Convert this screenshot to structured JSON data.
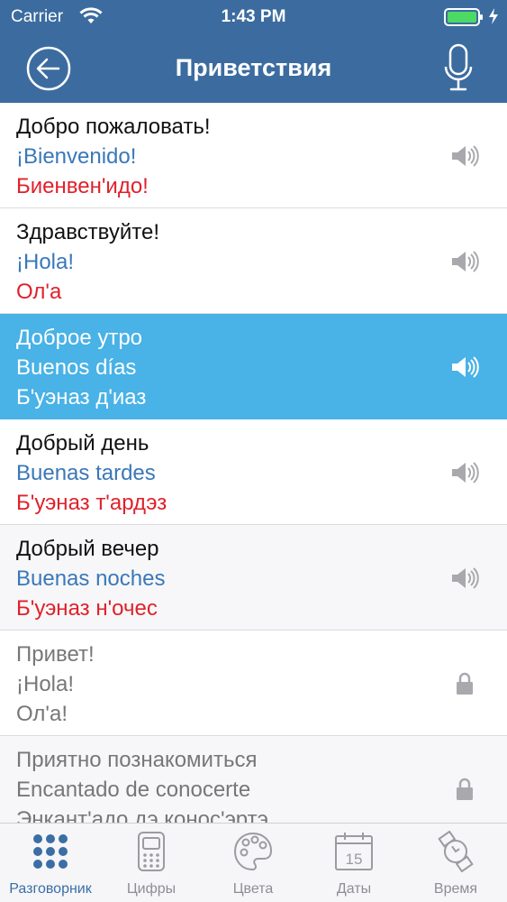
{
  "status_bar": {
    "carrier": "Carrier",
    "time": "1:43 PM"
  },
  "nav": {
    "title": "Приветствия"
  },
  "phrases": [
    {
      "ru": "Добро пожаловать!",
      "es": "¡Bienvenido!",
      "tr": "Биенвен'идо!",
      "state": "normal",
      "icon": "speaker-icon"
    },
    {
      "ru": "Здравствуйте!",
      "es": "¡Hola!",
      "tr": "Ол'а",
      "state": "normal",
      "icon": "speaker-icon"
    },
    {
      "ru": "Доброе утро",
      "es": "Buenos días",
      "tr": "Б'уэназ д'иаз",
      "state": "selected",
      "icon": "speaker-icon"
    },
    {
      "ru": "Добрый день",
      "es": "Buenas tardes",
      "tr": "Б'уэназ т'ардэз",
      "state": "normal",
      "icon": "speaker-icon"
    },
    {
      "ru": "Добрый вечер",
      "es": "Buenas noches",
      "tr": "Б'уэназ н'очес",
      "state": "normal",
      "icon": "speaker-icon"
    },
    {
      "ru": "Привет!",
      "es": "¡Hola!",
      "tr": "Ол'а!",
      "state": "locked",
      "icon": "lock-icon"
    },
    {
      "ru": "Приятно познакомиться",
      "es": "Encantado de conocerte",
      "tr": "Энкант'адо дэ конос'эртэ",
      "state": "locked",
      "icon": "lock-icon"
    }
  ],
  "tabs": [
    {
      "label": "Разговорник",
      "icon": "grid-dots-icon",
      "active": true
    },
    {
      "label": "Цифры",
      "icon": "calculator-icon",
      "active": false
    },
    {
      "label": "Цвета",
      "icon": "palette-icon",
      "active": false
    },
    {
      "label": "Даты",
      "icon": "calendar-icon",
      "active": false,
      "icon_text": "15"
    },
    {
      "label": "Время",
      "icon": "watch-icon",
      "active": false
    }
  ],
  "colors": {
    "header": "#3c6c9f",
    "selected_row": "#49b2e6",
    "spanish_text": "#3a78b8",
    "transcription_text": "#e0212b",
    "tab_active": "#3a6ea5",
    "tab_inactive": "#8e8e93"
  }
}
